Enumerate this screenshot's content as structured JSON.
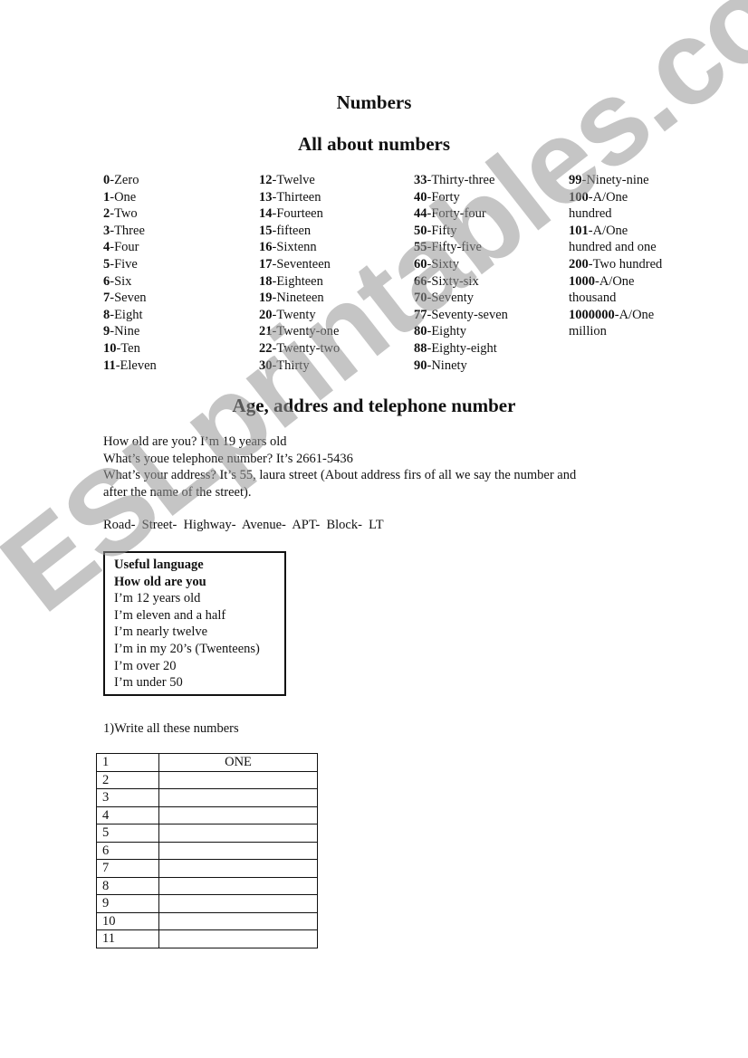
{
  "title": "Numbers",
  "subtitle": "All about numbers",
  "numbers_columns": [
    [
      {
        "n": "0",
        "w": "-Zero"
      },
      {
        "n": "1",
        "w": "-One"
      },
      {
        "n": "2",
        "w": "-Two"
      },
      {
        "n": "3",
        "w": "-Three"
      },
      {
        "n": "4",
        "w": "-Four"
      },
      {
        "n": "5",
        "w": "-Five"
      },
      {
        "n": "6",
        "w": "-Six"
      },
      {
        "n": "7",
        "w": "-Seven"
      },
      {
        "n": "8",
        "w": "-Eight"
      },
      {
        "n": "9",
        "w": "-Nine"
      },
      {
        "n": "10",
        "w": "-Ten"
      },
      {
        "n": "11",
        "w": "-Eleven"
      }
    ],
    [
      {
        "n": "12",
        "w": "-Twelve"
      },
      {
        "n": "13",
        "w": "-Thirteen"
      },
      {
        "n": "14",
        "w": "-Fourteen"
      },
      {
        "n": "15",
        "w": "-fifteen"
      },
      {
        "n": "16",
        "w": "-Sixtenn"
      },
      {
        "n": "17",
        "w": "-Seventeen"
      },
      {
        "n": "18",
        "w": "-Eighteen"
      },
      {
        "n": "19",
        "w": "-Nineteen"
      },
      {
        "n": "20",
        "w": "-Twenty"
      },
      {
        "n": "21",
        "w": "-Twenty-one"
      },
      {
        "n": "22",
        "w": "-Twenty-two"
      },
      {
        "n": "30",
        "w": "-Thirty"
      }
    ],
    [
      {
        "n": "33",
        "w": "-Thirty-three"
      },
      {
        "n": "40",
        "w": "-Forty"
      },
      {
        "n": "44",
        "w": "-Forty-four"
      },
      {
        "n": "50",
        "w": "-Fifty"
      },
      {
        "n": "55",
        "w": "-Fifty-five"
      },
      {
        "n": "60",
        "w": "-Sixty"
      },
      {
        "n": "66",
        "w": "-Sixty-six"
      },
      {
        "n": "70",
        "w": "-Seventy"
      },
      {
        "n": "77",
        "w": "-Seventy-seven"
      },
      {
        "n": "80",
        "w": "-Eighty"
      },
      {
        "n": "88",
        "w": "-Eighty-eight"
      },
      {
        "n": "90",
        "w": "-Ninety"
      }
    ],
    [
      {
        "n": "99",
        "w": "-Ninety-nine"
      },
      {
        "n": "100",
        "w": "-A/One"
      },
      {
        "n": "",
        "w": "hundred"
      },
      {
        "n": "101",
        "w": "-A/One"
      },
      {
        "n": "",
        "w": "hundred and one"
      },
      {
        "n": "200",
        "w": "-Two hundred"
      },
      {
        "n": "1000",
        "w": "-A/One"
      },
      {
        "n": "",
        "w": "thousand"
      },
      {
        "n": "1000000",
        "w": "-A/One"
      },
      {
        "n": "",
        "w": "million"
      }
    ]
  ],
  "section2_title": "Age, addres and telephone number",
  "paragraph_lines": [
    "How old are you? I’m 19 years old",
    "What’s youe telephone number? It’s 2661-5436",
    "What’s your address? It’s 55, laura street (About address firs of all we say the number and",
    "after the name of the street)."
  ],
  "street_types": "Road-  Street-  Highway-  Avenue-  APT-  Block-  LT",
  "useful_box": {
    "heading": "Useful language",
    "subheading": "How old are you",
    "lines": [
      "I’m 12 years old",
      "I’m eleven and a half",
      "I’m nearly twelve",
      "I’m in my 20’s (Twenteens)",
      "I’m over 20",
      "I’m under 50"
    ]
  },
  "exercise_title": "1)Write all these numbers",
  "exercise_rows": [
    {
      "num": "1",
      "answer": "ONE"
    },
    {
      "num": "2",
      "answer": ""
    },
    {
      "num": "3",
      "answer": ""
    },
    {
      "num": "4",
      "answer": ""
    },
    {
      "num": "5",
      "answer": ""
    },
    {
      "num": "6",
      "answer": ""
    },
    {
      "num": "7",
      "answer": ""
    },
    {
      "num": "8",
      "answer": ""
    },
    {
      "num": "9",
      "answer": ""
    },
    {
      "num": "10",
      "answer": ""
    },
    {
      "num": "11",
      "answer": ""
    }
  ],
  "watermark": "ESLprintables.com"
}
